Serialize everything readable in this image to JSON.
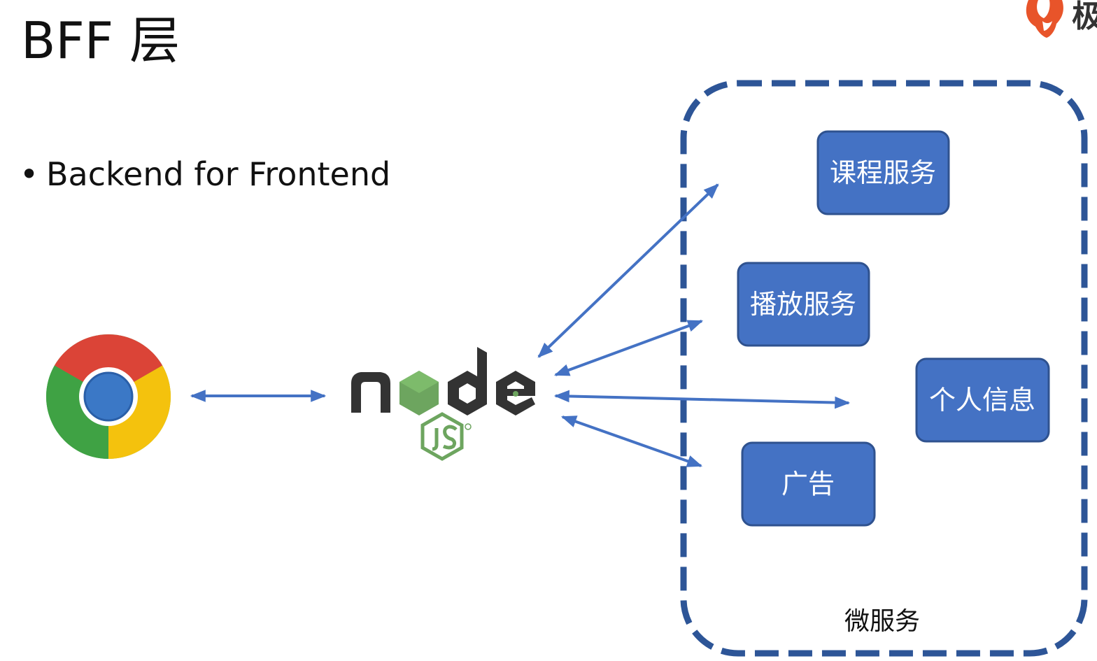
{
  "slide": {
    "title": "BFF 层",
    "bullet": "•",
    "bullet_text": "Backend for Frontend"
  },
  "corner_logo": {
    "text": "极",
    "icon": "flame-logo-icon",
    "color": "#e8542a"
  },
  "diagram": {
    "client_icon": "chrome-browser-icon",
    "bff_icon": "nodejs-logo-icon",
    "microservices_group": {
      "label": "微服务",
      "border_color": "#2d5597"
    },
    "services": [
      {
        "id": "course",
        "label": "课程服务"
      },
      {
        "id": "playback",
        "label": "播放服务"
      },
      {
        "id": "profile",
        "label": "个人信息"
      },
      {
        "id": "ads",
        "label": "广告"
      }
    ],
    "colors": {
      "service_fill": "#4472c4",
      "service_border": "#2f528f",
      "arrow": "#4472c4",
      "service_text": "#ffffff",
      "group_text": "#111111",
      "node_dark": "#333333",
      "node_green": "#6da55f",
      "node_green_dark": "#3e863d"
    }
  }
}
